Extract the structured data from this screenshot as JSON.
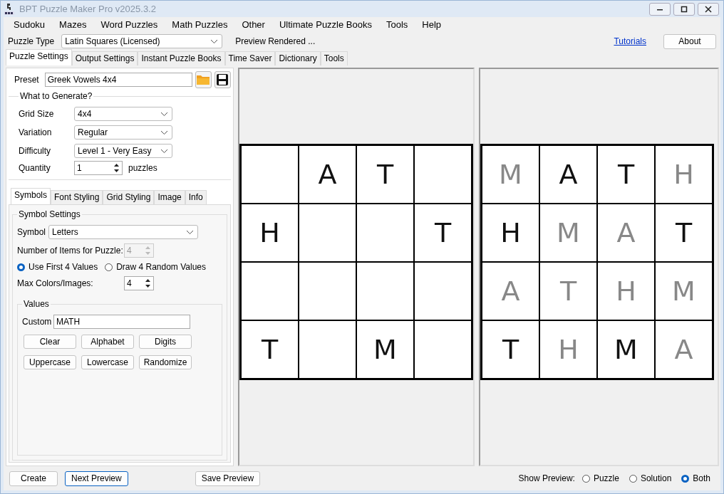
{
  "window": {
    "title": "BPT Puzzle Maker Pro v2025.3.2"
  },
  "menu": [
    "Sudoku",
    "Mazes",
    "Word Puzzles",
    "Math Puzzles",
    "Other",
    "Ultimate Puzzle Books",
    "Tools",
    "Help"
  ],
  "puzzle_type": {
    "label": "Puzzle Type",
    "value": "Latin Squares (Licensed)",
    "status": "Preview Rendered ...",
    "link": "Tutorials",
    "about": "About"
  },
  "tabs": [
    {
      "label": "Puzzle Settings",
      "selected": true
    },
    {
      "label": "Output Settings",
      "selected": false
    },
    {
      "label": "Instant Puzzle Books",
      "selected": false
    },
    {
      "label": "Time Saver",
      "selected": false
    },
    {
      "label": "Dictionary",
      "selected": false
    },
    {
      "label": "Tools",
      "selected": false
    }
  ],
  "preset": {
    "label": "Preset",
    "value": "Greek Vowels 4x4"
  },
  "generate": {
    "title": "What to Generate?",
    "fields": [
      {
        "label": "Grid Size",
        "value": "4x4"
      },
      {
        "label": "Variation",
        "value": "Regular"
      },
      {
        "label": "Difficulty",
        "value": "Level 1 - Very Easy"
      }
    ],
    "quantity": {
      "label": "Quantity",
      "value": "1",
      "unit": "puzzles"
    }
  },
  "sub_tabs": [
    {
      "label": "Symbols",
      "selected": true
    },
    {
      "label": "Font Styling",
      "selected": false
    },
    {
      "label": "Grid Styling",
      "selected": false
    },
    {
      "label": "Image",
      "selected": false
    },
    {
      "label": "Info",
      "selected": false
    }
  ],
  "symbol_settings": {
    "title": "Symbol Settings",
    "symbol_label": "Symbol",
    "symbol": "Letters",
    "items_label": "Number of Items for Puzzle:",
    "items": "4",
    "items_disabled": true,
    "options": [
      {
        "label": "Use First 4 Values",
        "selected": true
      },
      {
        "label": "Draw 4 Random Values",
        "selected": false
      }
    ],
    "max_label": "Max Colors/Images:",
    "max": "4",
    "values": {
      "title": "Values",
      "custom_label": "Custom",
      "custom": "MATH",
      "buttons": [
        "Clear",
        "Alphabet",
        "Digits",
        "Uppercase",
        "Lowercase",
        "Randomize"
      ]
    }
  },
  "puzzle_preview": {
    "rows": [
      [
        null,
        "A",
        "T",
        null
      ],
      [
        "H",
        null,
        null,
        "T"
      ],
      [
        null,
        null,
        null,
        null
      ],
      [
        "T",
        null,
        "M",
        null
      ]
    ]
  },
  "solution_preview": {
    "rows": [
      [
        {
          "letter": "M",
          "given": false
        },
        {
          "letter": "A",
          "given": true
        },
        {
          "letter": "T",
          "given": true
        },
        {
          "letter": "H",
          "given": false
        }
      ],
      [
        {
          "letter": "H",
          "given": true
        },
        {
          "letter": "M",
          "given": false
        },
        {
          "letter": "A",
          "given": false
        },
        {
          "letter": "T",
          "given": true
        }
      ],
      [
        {
          "letter": "A",
          "given": false
        },
        {
          "letter": "T",
          "given": false
        },
        {
          "letter": "H",
          "given": false
        },
        {
          "letter": "M",
          "given": false
        }
      ],
      [
        {
          "letter": "T",
          "given": true
        },
        {
          "letter": "H",
          "given": false
        },
        {
          "letter": "M",
          "given": true
        },
        {
          "letter": "A",
          "given": false
        }
      ]
    ]
  },
  "bottom": {
    "buttons": [
      {
        "label": "Create",
        "focused": false
      },
      {
        "label": "Next Preview",
        "focused": true
      }
    ],
    "save": "Save Preview",
    "show_label": "Show Preview:",
    "show_options": [
      {
        "label": "Puzzle",
        "selected": false
      },
      {
        "label": "Solution",
        "selected": false
      },
      {
        "label": "Both",
        "selected": true
      }
    ]
  }
}
